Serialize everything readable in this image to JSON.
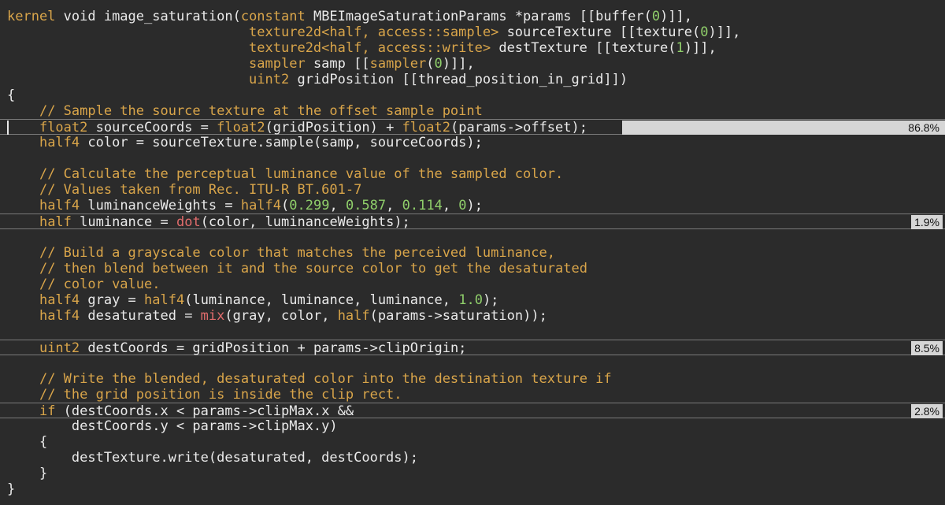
{
  "editor": {
    "lines": [
      {
        "tokens": [
          [
            "kw",
            "kernel"
          ],
          [
            "plain",
            " void image_saturation("
          ],
          [
            "kw",
            "constant"
          ],
          [
            "plain",
            " MBEImageSaturationParams *params [[buffer("
          ],
          [
            "num",
            "0"
          ],
          [
            "plain",
            ")]],"
          ]
        ]
      },
      {
        "tokens": [
          [
            "plain",
            "                              "
          ],
          [
            "kw",
            "texture2d<half, access::sample>"
          ],
          [
            "plain",
            " sourceTexture [[texture("
          ],
          [
            "num",
            "0"
          ],
          [
            "plain",
            ")]],"
          ]
        ]
      },
      {
        "tokens": [
          [
            "plain",
            "                              "
          ],
          [
            "kw",
            "texture2d<half, access::write>"
          ],
          [
            "plain",
            " destTexture [[texture("
          ],
          [
            "num",
            "1"
          ],
          [
            "plain",
            ")]],"
          ]
        ]
      },
      {
        "tokens": [
          [
            "plain",
            "                              "
          ],
          [
            "kw",
            "sampler"
          ],
          [
            "plain",
            " samp [["
          ],
          [
            "kw",
            "sampler"
          ],
          [
            "plain",
            "("
          ],
          [
            "num",
            "0"
          ],
          [
            "plain",
            ")]],"
          ]
        ]
      },
      {
        "tokens": [
          [
            "plain",
            "                              "
          ],
          [
            "kw",
            "uint2"
          ],
          [
            "plain",
            " gridPosition [[thread_position_in_grid]])"
          ]
        ]
      },
      {
        "tokens": [
          [
            "plain",
            "{"
          ]
        ]
      },
      {
        "tokens": [
          [
            "plain",
            "    "
          ],
          [
            "cmt",
            "// Sample the source texture at the offset sample point"
          ]
        ]
      },
      {
        "tokens": [
          [
            "plain",
            "    "
          ],
          [
            "kw",
            "float2"
          ],
          [
            "plain",
            " sourceCoords = "
          ],
          [
            "kw",
            "float2"
          ],
          [
            "plain",
            "(gridPosition) + "
          ],
          [
            "kw",
            "float2"
          ],
          [
            "plain",
            "(params->offset);"
          ]
        ],
        "coverage": "86.8%",
        "coverage_fraction": 0.342,
        "caret": true
      },
      {
        "tokens": [
          [
            "plain",
            "    "
          ],
          [
            "kw",
            "half4"
          ],
          [
            "plain",
            " color = sourceTexture.sample(samp, sourceCoords);"
          ]
        ]
      },
      {
        "tokens": [
          [
            "plain",
            ""
          ]
        ]
      },
      {
        "tokens": [
          [
            "plain",
            "    "
          ],
          [
            "cmt",
            "// Calculate the perceptual luminance value of the sampled color."
          ]
        ]
      },
      {
        "tokens": [
          [
            "plain",
            "    "
          ],
          [
            "cmt",
            "// Values taken from Rec. ITU-R BT.601-7"
          ]
        ]
      },
      {
        "tokens": [
          [
            "plain",
            "    "
          ],
          [
            "kw",
            "half4"
          ],
          [
            "plain",
            " luminanceWeights = "
          ],
          [
            "kw",
            "half4"
          ],
          [
            "plain",
            "("
          ],
          [
            "num",
            "0.299"
          ],
          [
            "plain",
            ", "
          ],
          [
            "num",
            "0.587"
          ],
          [
            "plain",
            ", "
          ],
          [
            "num",
            "0.114"
          ],
          [
            "plain",
            ", "
          ],
          [
            "num",
            "0"
          ],
          [
            "plain",
            ");"
          ]
        ]
      },
      {
        "tokens": [
          [
            "plain",
            "    "
          ],
          [
            "kw",
            "half"
          ],
          [
            "plain",
            " luminance = "
          ],
          [
            "fn",
            "dot"
          ],
          [
            "plain",
            "(color, luminanceWeights);"
          ]
        ],
        "coverage": "1.9%",
        "coverage_fraction": 0.0
      },
      {
        "tokens": [
          [
            "plain",
            ""
          ]
        ]
      },
      {
        "tokens": [
          [
            "plain",
            "    "
          ],
          [
            "cmt",
            "// Build a grayscale color that matches the perceived luminance,"
          ]
        ]
      },
      {
        "tokens": [
          [
            "plain",
            "    "
          ],
          [
            "cmt",
            "// then blend between it and the source color to get the desaturated"
          ]
        ]
      },
      {
        "tokens": [
          [
            "plain",
            "    "
          ],
          [
            "cmt",
            "// color value."
          ]
        ]
      },
      {
        "tokens": [
          [
            "plain",
            "    "
          ],
          [
            "kw",
            "half4"
          ],
          [
            "plain",
            " gray = "
          ],
          [
            "kw",
            "half4"
          ],
          [
            "plain",
            "(luminance, luminance, luminance, "
          ],
          [
            "num",
            "1.0"
          ],
          [
            "plain",
            ");"
          ]
        ]
      },
      {
        "tokens": [
          [
            "plain",
            "    "
          ],
          [
            "kw",
            "half4"
          ],
          [
            "plain",
            " desaturated = "
          ],
          [
            "fn",
            "mix"
          ],
          [
            "plain",
            "(gray, color, "
          ],
          [
            "kw",
            "half"
          ],
          [
            "plain",
            "(params->saturation));"
          ]
        ]
      },
      {
        "tokens": [
          [
            "plain",
            ""
          ]
        ]
      },
      {
        "tokens": [
          [
            "plain",
            "    "
          ],
          [
            "kw",
            "uint2"
          ],
          [
            "plain",
            " destCoords = gridPosition + params->clipOrigin;"
          ]
        ],
        "coverage": "8.5%",
        "coverage_fraction": 0.0
      },
      {
        "tokens": [
          [
            "plain",
            ""
          ]
        ]
      },
      {
        "tokens": [
          [
            "plain",
            "    "
          ],
          [
            "cmt",
            "// Write the blended, desaturated color into the destination texture if"
          ]
        ]
      },
      {
        "tokens": [
          [
            "plain",
            "    "
          ],
          [
            "cmt",
            "// the grid position is inside the clip rect."
          ]
        ]
      },
      {
        "tokens": [
          [
            "plain",
            "    "
          ],
          [
            "kw",
            "if"
          ],
          [
            "plain",
            " (destCoords.x < params->clipMax.x &&"
          ]
        ],
        "coverage": "2.8%",
        "coverage_fraction": 0.0
      },
      {
        "tokens": [
          [
            "plain",
            "        destCoords.y < params->clipMax.y)"
          ]
        ]
      },
      {
        "tokens": [
          [
            "plain",
            "    {"
          ]
        ]
      },
      {
        "tokens": [
          [
            "plain",
            "        destTexture.write(desaturated, destCoords);"
          ]
        ]
      },
      {
        "tokens": [
          [
            "plain",
            "    }"
          ]
        ]
      },
      {
        "tokens": [
          [
            "plain",
            "}"
          ]
        ]
      }
    ]
  },
  "colors": {
    "background": "#2b2b2b",
    "keyword": "#d9a54a",
    "number": "#8fce6a",
    "builtin_function": "#e06c6c",
    "comment": "#d9a54a",
    "text": "#eaeaea",
    "coverage_bar": "#d6d6d6"
  }
}
